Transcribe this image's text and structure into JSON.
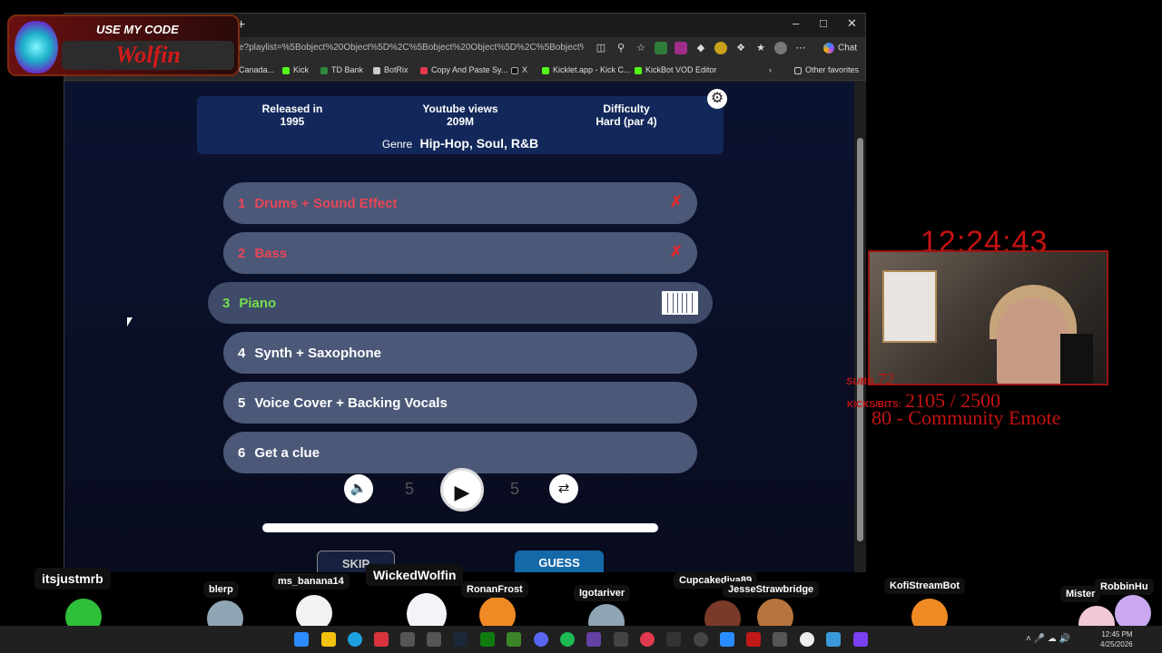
{
  "browser": {
    "url": "e?playlist=%5Bobject%20Object%5D%2C%5Bobject%20Object%5D%2C%5Bobject%20Object%5D%2C%5Bobject%20Obj...",
    "chat_label": "Chat",
    "new_tab": "+",
    "bookmarks": [
      "Canada...",
      "Kick",
      "TD Bank",
      "BotRix",
      "Copy And Paste Sy...",
      "X",
      "Kicklet.app - Kick C...",
      "KickBot VOD Editor"
    ],
    "other_favorites": "Other favorites"
  },
  "song": {
    "released_label": "Released in",
    "released_value": "1995",
    "views_label": "Youtube views",
    "views_value": "209M",
    "difficulty_label": "Difficulty",
    "difficulty_value": "Hard (par 4)",
    "genre_label": "Genre",
    "genre_value": "Hip-Hop, Soul, R&B"
  },
  "tracks": [
    {
      "num": "1",
      "label": "Drums + Sound Effect",
      "state": "failed"
    },
    {
      "num": "2",
      "label": "Bass",
      "state": "failed"
    },
    {
      "num": "3",
      "label": "Piano",
      "state": "active"
    },
    {
      "num": "4",
      "label": "Synth + Saxophone",
      "state": "locked"
    },
    {
      "num": "5",
      "label": "Voice Cover + Backing Vocals",
      "state": "locked"
    },
    {
      "num": "6",
      "label": "Get a clue",
      "state": "locked"
    }
  ],
  "controls": {
    "skip_label": "SKIP",
    "guess_label": "GUESS",
    "rewind_label": "5",
    "forward_label": "5"
  },
  "colors": {
    "failed": "#e74656",
    "active": "#73df51",
    "accent_red": "#c51212",
    "guess_blue": "#1469a8"
  },
  "overlay": {
    "promo_line1": "USE MY CODE",
    "promo_line2": "Wolfin",
    "clock": "12:24:43",
    "subs_label": "SUBS",
    "subs_value": "72",
    "kicks_label": "KICKS/BITS:",
    "kicks_value": "2105 / 2500",
    "emote_goal": "80 - Community Emote"
  },
  "chatters": [
    "itsjustmrb",
    "blerp",
    "ms_banana14",
    "WickedWolfin",
    "RonanFrost",
    "Igotariver",
    "Cupcakediva89",
    "JesseStrawbridge",
    "KofiStreamBot",
    "Mister",
    "RobbinHu"
  ],
  "taskbar": {
    "time": "12:45 PM",
    "date": "4/25/2026"
  }
}
